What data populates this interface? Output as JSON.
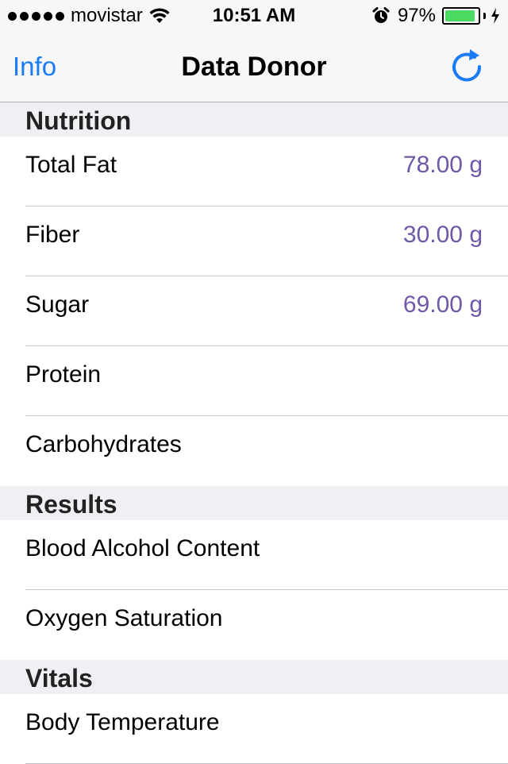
{
  "status_bar": {
    "carrier": "movistar",
    "time": "10:51 AM",
    "battery_percent": "97%",
    "battery_level": 0.97
  },
  "nav": {
    "left_label": "Info",
    "title": "Data Donor",
    "right_icon": "refresh-icon"
  },
  "accent_color": "#1a7bf5",
  "value_color": "#6f58a8",
  "sections": [
    {
      "title": "Nutrition",
      "rows": [
        {
          "label": "Total Fat",
          "value": "78.00 g"
        },
        {
          "label": "Fiber",
          "value": "30.00 g"
        },
        {
          "label": "Sugar",
          "value": "69.00 g"
        },
        {
          "label": "Protein",
          "value": ""
        },
        {
          "label": "Carbohydrates",
          "value": ""
        }
      ]
    },
    {
      "title": "Results",
      "rows": [
        {
          "label": "Blood Alcohol Content",
          "value": ""
        },
        {
          "label": "Oxygen Saturation",
          "value": ""
        }
      ]
    },
    {
      "title": "Vitals",
      "rows": [
        {
          "label": "Body Temperature",
          "value": ""
        }
      ]
    }
  ]
}
